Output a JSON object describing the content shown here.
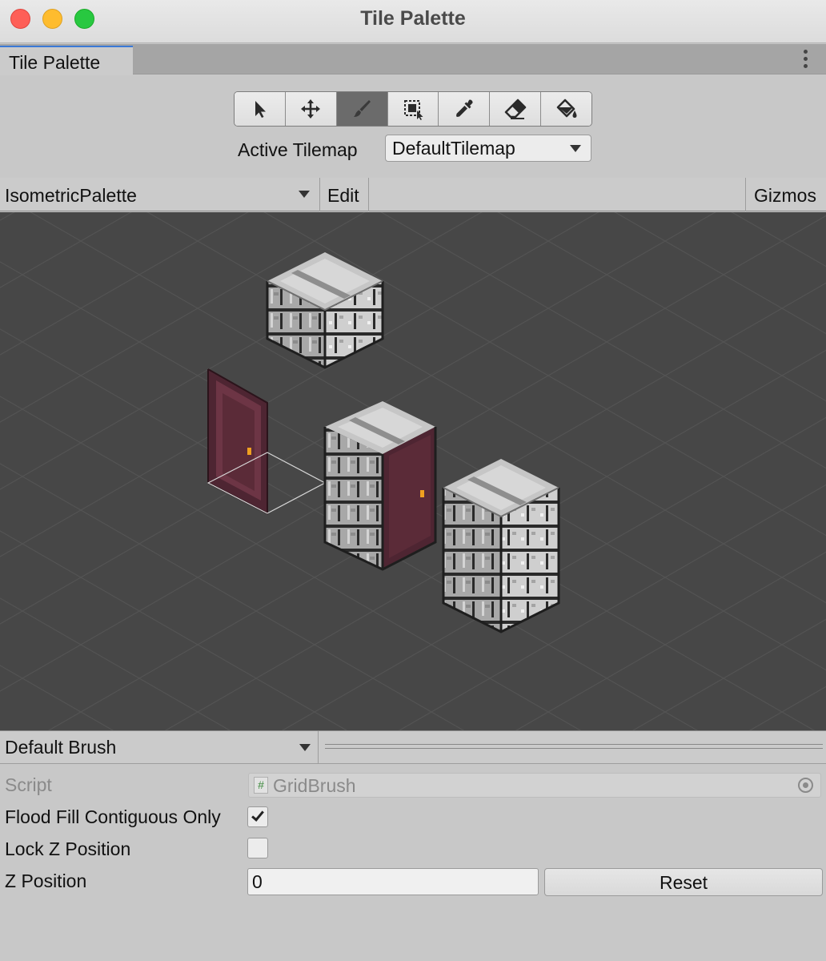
{
  "window": {
    "title": "Tile Palette"
  },
  "tab": {
    "label": "Tile Palette"
  },
  "toolbar": {
    "tools": [
      {
        "name": "select-tool",
        "icon": "select-arrow-icon",
        "active": false
      },
      {
        "name": "move-tool",
        "icon": "move-arrows-icon",
        "active": false
      },
      {
        "name": "paint-tool",
        "icon": "paintbrush-icon",
        "active": true
      },
      {
        "name": "box-fill-tool",
        "icon": "box-fill-icon",
        "active": false
      },
      {
        "name": "pick-tool",
        "icon": "eyedropper-icon",
        "active": false
      },
      {
        "name": "erase-tool",
        "icon": "eraser-icon",
        "active": false
      },
      {
        "name": "fill-tool",
        "icon": "paint-bucket-icon",
        "active": false
      }
    ],
    "active_tilemap_label": "Active Tilemap",
    "active_tilemap_value": "DefaultTilemap"
  },
  "palette_header": {
    "palette_name": "IsometricPalette",
    "edit_label": "Edit",
    "gizmos_label": "Gizmos"
  },
  "brush": {
    "name": "Default Brush",
    "script_label": "Script",
    "script_value": "GridBrush",
    "flood_fill_label": "Flood Fill Contiguous Only",
    "flood_fill_checked": true,
    "lock_z_label": "Lock Z Position",
    "lock_z_checked": false,
    "z_position_label": "Z Position",
    "z_position_value": "0",
    "reset_label": "Reset"
  },
  "colors": {
    "canvas_bg": "#474747",
    "grid_line": "#565656",
    "stone_light": "#bdbdbd",
    "door": "#5b2b38",
    "accent": "#3a79d6"
  }
}
